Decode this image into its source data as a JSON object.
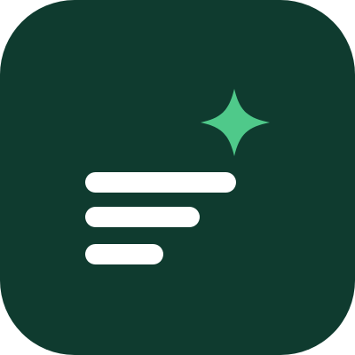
{
  "icon": {
    "name": "app-icon",
    "glyph": "lines-with-sparkle",
    "colors": {
      "tile": "#0f3b2f",
      "bars": "#ffffff",
      "sparkle": "#4fc98a",
      "page_background": "#ffffff"
    }
  }
}
